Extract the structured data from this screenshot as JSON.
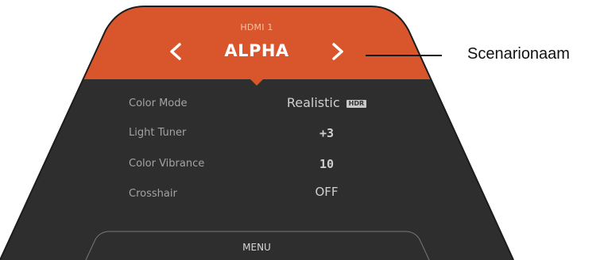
{
  "header": {
    "input_source": "HDMI 1",
    "preset_name": "ALPHA",
    "prev_icon": "chevron-left-icon",
    "next_icon": "chevron-right-icon"
  },
  "settings": [
    {
      "label": "Color Mode",
      "value": "Realistic",
      "badge": "HDR"
    },
    {
      "label": "Light Tuner",
      "value": "+3"
    },
    {
      "label": "Color Vibrance",
      "value": "10"
    },
    {
      "label": "Crosshair",
      "value": "OFF"
    }
  ],
  "footer": {
    "menu_label": "MENU"
  },
  "callout": {
    "text": "Scenarionaam"
  },
  "colors": {
    "header": "#d9562d",
    "body": "#2e2e2e",
    "outline": "#1c1c1c",
    "text_label": "#a3a3a3",
    "text_value": "#cfcfcf"
  }
}
